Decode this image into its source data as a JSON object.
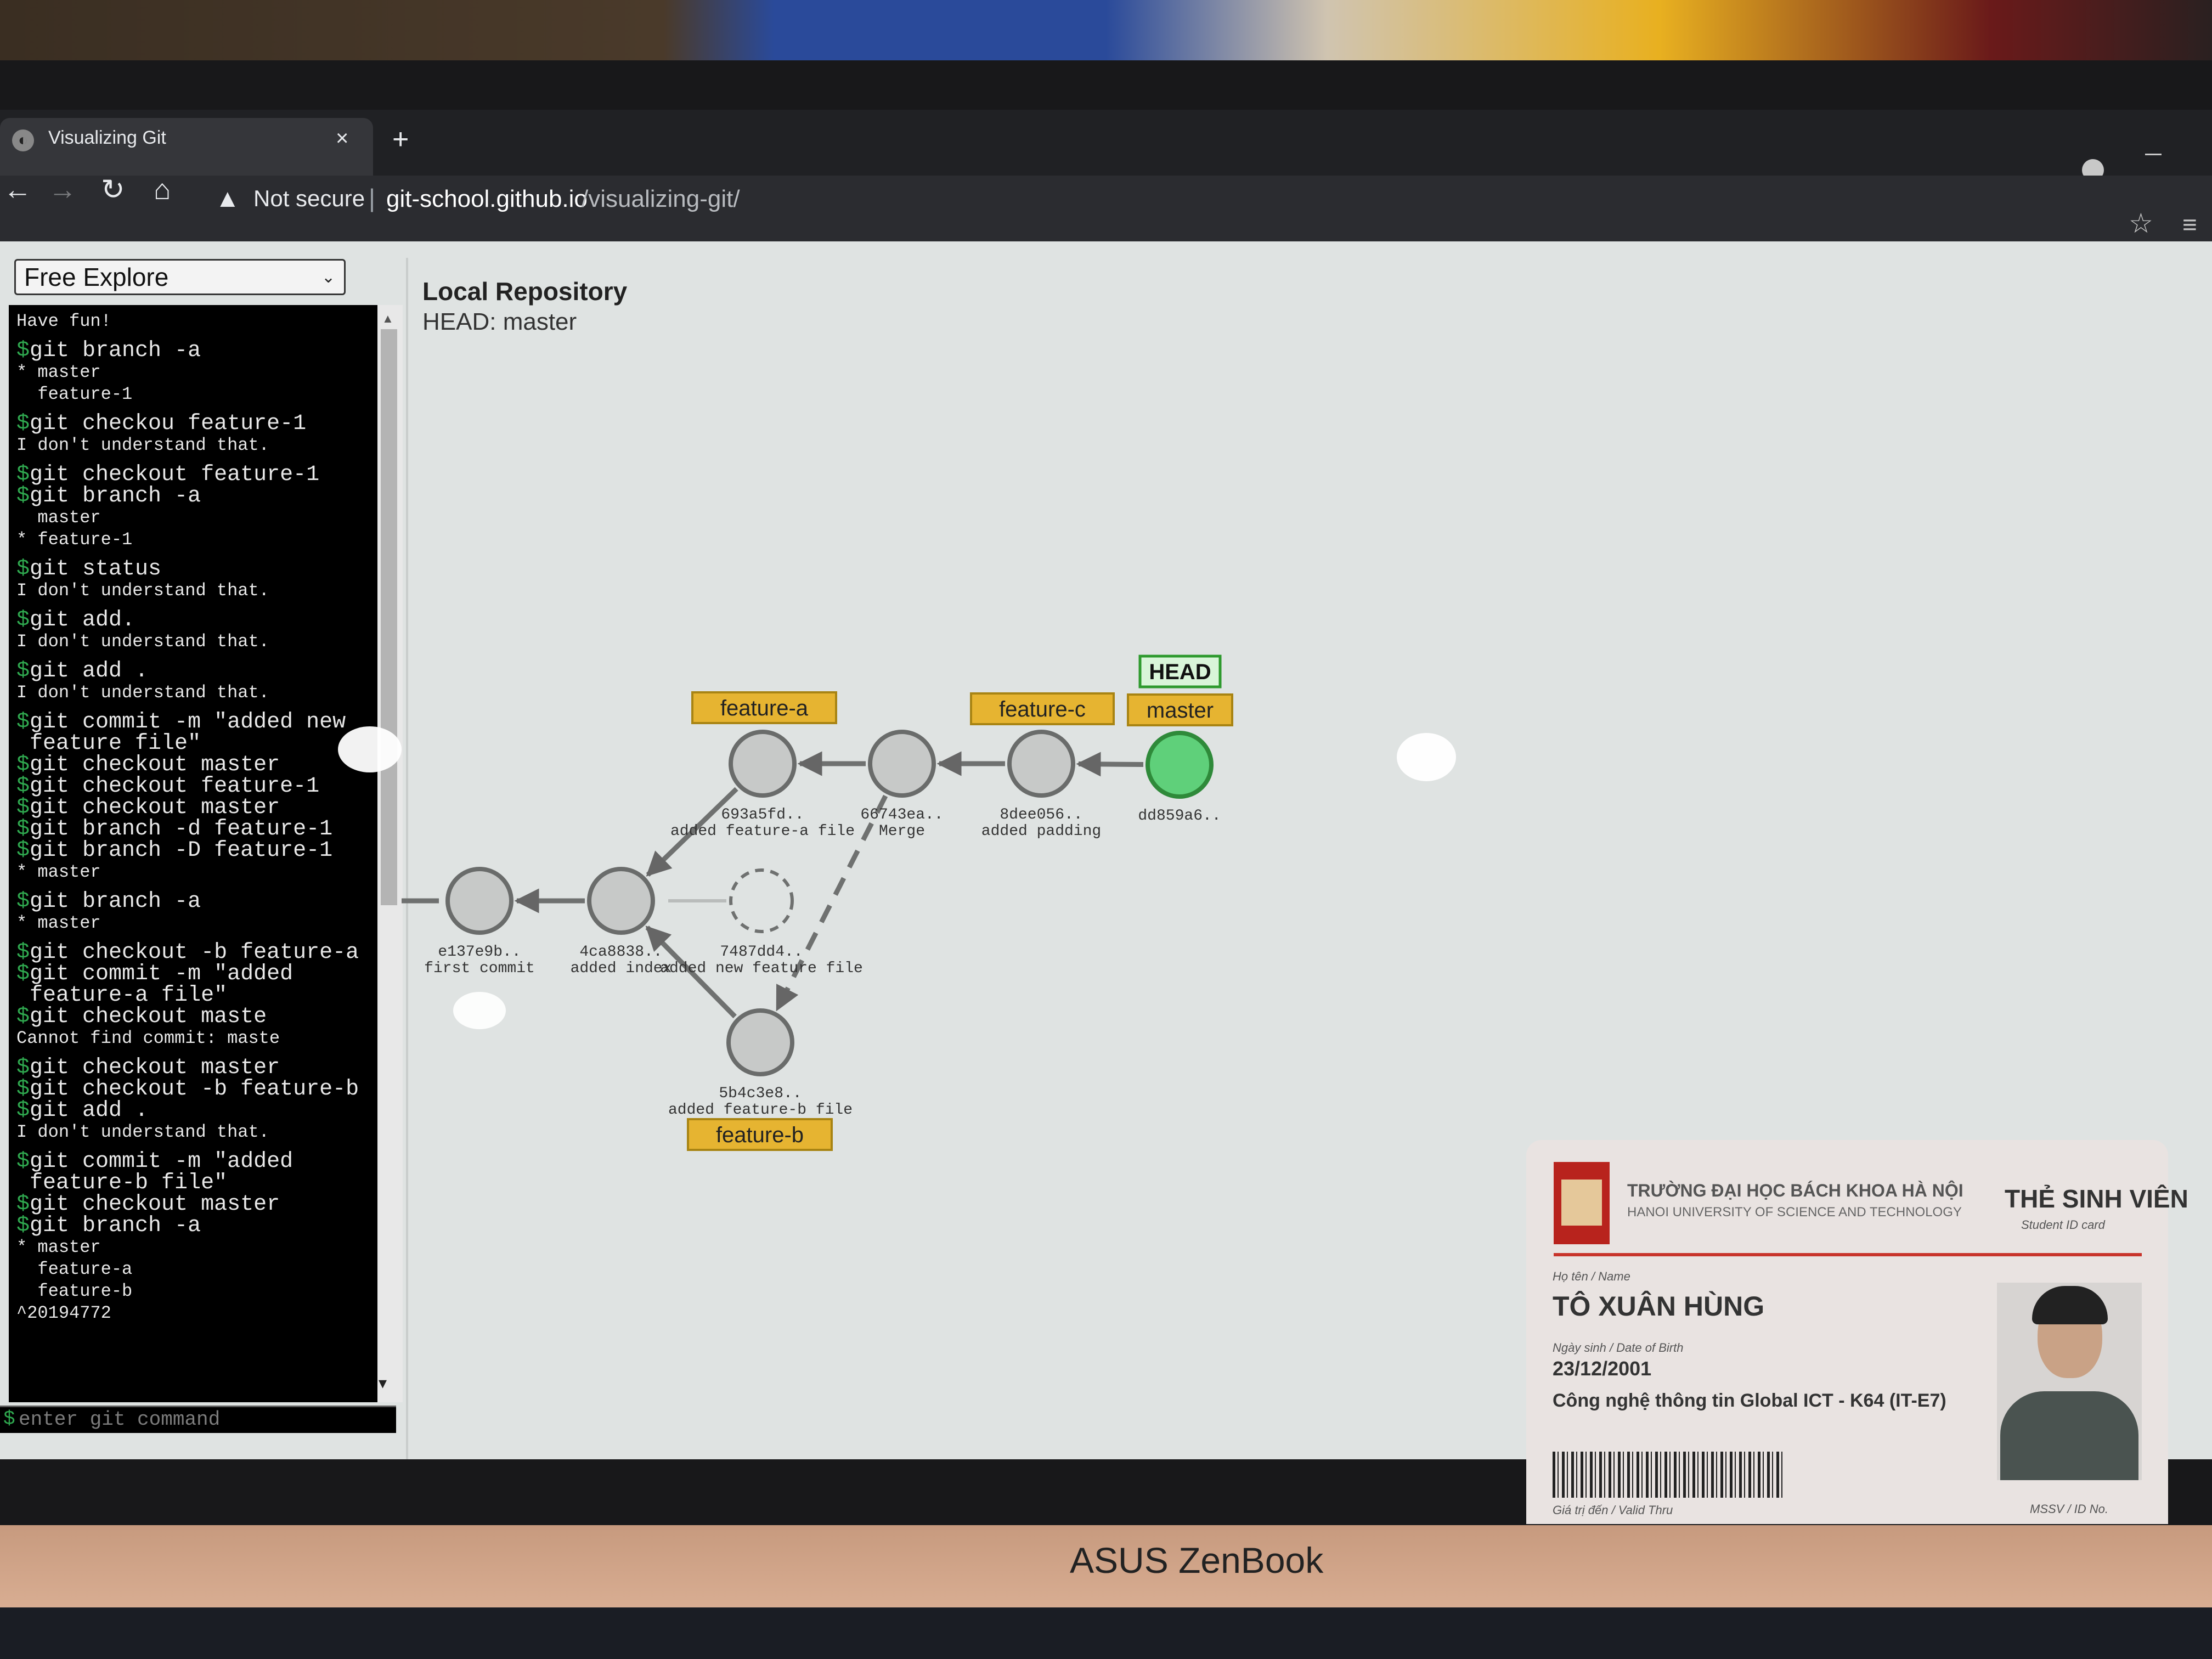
{
  "browser": {
    "tab_title": "Visualizing Git",
    "tab_close": "×",
    "new_tab": "+",
    "security_label": "Not secure",
    "url_separator": "|",
    "url_host": "git-school.github.io",
    "url_path": "/visualizing-git/",
    "icons": [
      "back-icon",
      "forward-icon",
      "reload-icon",
      "home-icon",
      "warning-icon",
      "star-icon",
      "reading-list-icon"
    ]
  },
  "sidebar": {
    "mode_select": "Free Explore",
    "terminal_lines": [
      {
        "type": "out",
        "text": "Have fun!"
      },
      {
        "type": "cmd",
        "text": "git branch -a"
      },
      {
        "type": "out",
        "text": "* master"
      },
      {
        "type": "out",
        "text": "  feature-1"
      },
      {
        "type": "cmd",
        "text": "git checkou feature-1"
      },
      {
        "type": "out",
        "text": "I don't understand that."
      },
      {
        "type": "cmd",
        "text": "git checkout feature-1"
      },
      {
        "type": "cmd",
        "text": "git branch -a"
      },
      {
        "type": "out",
        "text": "  master"
      },
      {
        "type": "out",
        "text": "* feature-1"
      },
      {
        "type": "cmd",
        "text": "git status"
      },
      {
        "type": "out",
        "text": "I don't understand that."
      },
      {
        "type": "cmd",
        "text": "git add."
      },
      {
        "type": "out",
        "text": "I don't understand that."
      },
      {
        "type": "cmd",
        "text": "git add ."
      },
      {
        "type": "out",
        "text": "I don't understand that."
      },
      {
        "type": "cmd",
        "text": "git commit -m \"added new"
      },
      {
        "type": "cmd",
        "text": "feature file\"",
        "continuation": true
      },
      {
        "type": "cmd",
        "text": "git checkout master"
      },
      {
        "type": "cmd",
        "text": "git checkout feature-1"
      },
      {
        "type": "cmd",
        "text": "git checkout master"
      },
      {
        "type": "cmd",
        "text": "git branch -d feature-1"
      },
      {
        "type": "cmd",
        "text": "git branch -D feature-1"
      },
      {
        "type": "out",
        "text": "* master"
      },
      {
        "type": "cmd",
        "text": "git branch -a"
      },
      {
        "type": "out",
        "text": "* master"
      },
      {
        "type": "cmd",
        "text": "git checkout -b feature-a"
      },
      {
        "type": "cmd",
        "text": "git commit -m \"added"
      },
      {
        "type": "cmd",
        "text": "feature-a file\"",
        "continuation": true
      },
      {
        "type": "cmd",
        "text": "git checkout maste"
      },
      {
        "type": "out",
        "text": "Cannot find commit: maste"
      },
      {
        "type": "cmd",
        "text": "git checkout master"
      },
      {
        "type": "cmd",
        "text": "git checkout -b feature-b"
      },
      {
        "type": "cmd",
        "text": "git add ."
      },
      {
        "type": "out",
        "text": "I don't understand that."
      },
      {
        "type": "cmd",
        "text": "git commit -m \"added"
      },
      {
        "type": "cmd",
        "text": "feature-b file\"",
        "continuation": true
      },
      {
        "type": "cmd",
        "text": "git checkout master"
      },
      {
        "type": "cmd",
        "text": "git branch -a"
      },
      {
        "type": "out",
        "text": "* master"
      },
      {
        "type": "out",
        "text": "  feature-a"
      },
      {
        "type": "out",
        "text": "  feature-b"
      },
      {
        "type": "out",
        "text": "^20194772"
      }
    ],
    "prompt_symbol": "$",
    "input_placeholder": "enter git command"
  },
  "repo": {
    "title": "Local Repository",
    "head_label": "HEAD: master",
    "commits": [
      {
        "id": "e137e9b..",
        "message": "first commit",
        "state": "normal"
      },
      {
        "id": "4ca8838..",
        "message": "added index",
        "state": "normal"
      },
      {
        "id": "7487dd4..",
        "message": "added new feature file",
        "state": "detached"
      },
      {
        "id": "693a5fd..",
        "message": "added feature-a file",
        "state": "normal"
      },
      {
        "id": "66743ea..",
        "message": "Merge",
        "state": "normal"
      },
      {
        "id": "8dee056..",
        "message": "added padding",
        "state": "normal"
      },
      {
        "id": "dd859a6..",
        "message": "",
        "state": "head"
      },
      {
        "id": "5b4c3e8..",
        "message": "added feature-b file",
        "state": "normal"
      }
    ],
    "branches": [
      {
        "name": "feature-a",
        "commit": "693a5fd.."
      },
      {
        "name": "feature-c",
        "commit": "8dee056.."
      },
      {
        "name": "master",
        "commit": "dd859a6.."
      },
      {
        "name": "feature-b",
        "commit": "5b4c3e8.."
      }
    ],
    "head_tag": "HEAD",
    "colors": {
      "commit_fill": "#c7c9c8",
      "head_commit_fill": "#5fd07a",
      "branch_tag": "#e6b431",
      "head_tag_border": "#2e9a2e"
    }
  },
  "id_card": {
    "school_vi": "TRƯỜNG ĐẠI HỌC BÁCH KHOA HÀ NỘI",
    "school_en": "HANOI UNIVERSITY OF SCIENCE AND TECHNOLOGY",
    "card_type_vi": "THẺ SINH VIÊN",
    "card_type_en": "Student ID card",
    "name_label": "Họ tên / Name",
    "name": "TÔ XUÂN HÙNG",
    "dob_label": "Ngày sinh / Date of Birth",
    "dob": "23/12/2001",
    "program": "Công nghệ thông tin Global ICT - K64 (IT-E7)",
    "valid_label": "Giá trị đến / Valid Thru",
    "id_label": "MSSV / ID No."
  },
  "laptop": {
    "brand": "ASUS ZenBook"
  }
}
